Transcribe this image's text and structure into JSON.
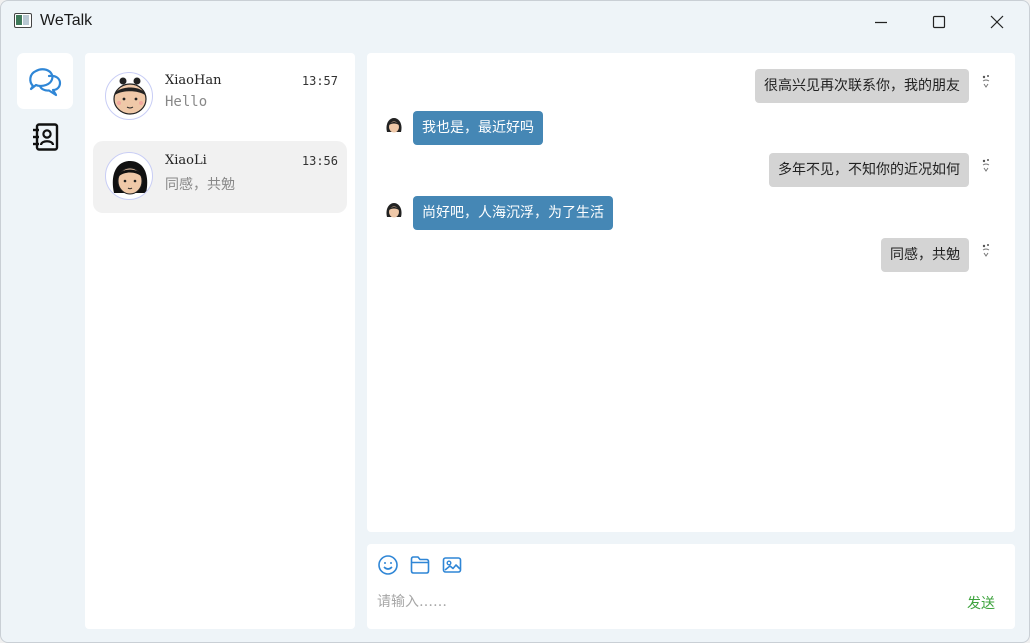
{
  "window": {
    "title": "WeTalk"
  },
  "nav": {
    "chat_icon": "chat-bubbles-icon",
    "contacts_icon": "contacts-book-icon"
  },
  "conversations": [
    {
      "name": "XiaoHan",
      "time": "13:57",
      "preview": "Hello",
      "selected": false
    },
    {
      "name": "XiaoLi",
      "time": "13:56",
      "preview": "同感，共勉",
      "selected": true
    }
  ],
  "messages": [
    {
      "direction": "out",
      "text": "很高兴见再次联系你，我的朋友"
    },
    {
      "direction": "in",
      "text": "我也是，最近好吗"
    },
    {
      "direction": "out",
      "text": "多年不见，不知你的近况如何"
    },
    {
      "direction": "in",
      "text": "尚好吧，人海沉浮，为了生活"
    },
    {
      "direction": "out",
      "text": "同感，共勉"
    }
  ],
  "composer": {
    "placeholder": "请输入……",
    "value": "",
    "send_label": "发送",
    "tools": [
      "emoji-icon",
      "folder-icon",
      "image-icon"
    ]
  },
  "colors": {
    "accent": "#2f86d6",
    "incoming_bubble": "#4587b5",
    "outgoing_bubble": "#d4d4d4",
    "send_text": "#3ea33e",
    "background": "#eef4f8"
  }
}
